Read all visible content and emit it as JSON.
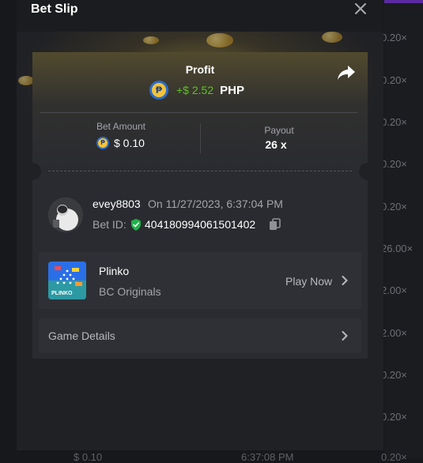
{
  "modal": {
    "title": "Bet Slip"
  },
  "profit": {
    "label": "Profit",
    "amount": "+$ 2.52",
    "currency": "PHP"
  },
  "stats": {
    "bet_amount_label": "Bet Amount",
    "bet_amount_value": "$ 0.10",
    "payout_label": "Payout",
    "payout_value": "26 x"
  },
  "bet": {
    "username": "evey8803",
    "date": "On 11/27/2023, 6:37:04 PM",
    "bet_id_label": "Bet ID:",
    "bet_id": "404180994061501402"
  },
  "game": {
    "name": "Plinko",
    "provider": "BC Originals",
    "play_label": "Play Now",
    "thumb_text": "PLINKO"
  },
  "details": {
    "label": "Game Details"
  },
  "background": {
    "multipliers": [
      "0.20×",
      "0.20×",
      "0.20×",
      "0.20×",
      "0.20×",
      "26.00×",
      "2.00×",
      "2.00×",
      "0.20×",
      "0.20×"
    ],
    "bottom_amount": "$ 0.10",
    "bottom_time": "6:37:08 PM",
    "bottom_mult": "0.20×"
  },
  "colors": {
    "accent_green": "#5dc41f",
    "modal_bg": "#202125",
    "card_bg": "#2a2b30"
  }
}
